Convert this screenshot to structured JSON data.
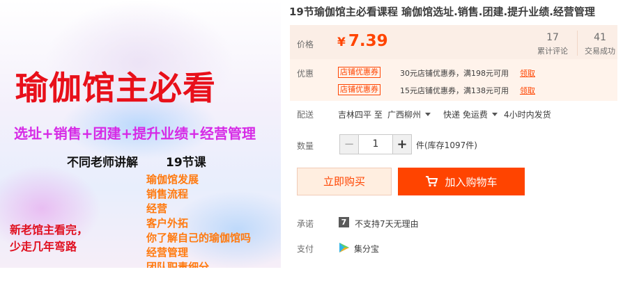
{
  "image": {
    "headline": "瑜伽馆主必看",
    "subline": "选址+销售+团建+提升业绩+经营管理",
    "teachers": "不同老师讲解",
    "lessons": "19节课",
    "topics": [
      "瑜伽馆发展",
      "销售流程",
      "经营",
      "客户外拓",
      "你了解自己的瑜伽馆吗",
      "经营管理",
      "团队职责细分"
    ],
    "newowner_line1": "新老馆主看完，",
    "newowner_line2": "少走几年弯路"
  },
  "product": {
    "title": "19节瑜伽馆主必看课程 瑜伽馆选址.销售.团建.提升业绩.经营管理"
  },
  "price": {
    "label": "价格",
    "currency": "¥",
    "value": "7.39"
  },
  "stats": {
    "reviews_count": "17",
    "reviews_label": "累计评论",
    "deals_count": "41",
    "deals_label": "交易成功"
  },
  "promo": {
    "label": "优惠",
    "items": [
      {
        "tag": "店铺优惠券",
        "text": "30元店铺优惠券，满198元可用",
        "action": "领取"
      },
      {
        "tag": "店铺优惠券",
        "text": "15元店铺优惠券，满138元可用",
        "action": "领取"
      }
    ]
  },
  "shipping": {
    "label": "配送",
    "from": "吉林四平 至",
    "to": "广西柳州",
    "method": "快递 免运费",
    "time": "4小时内发货"
  },
  "quantity": {
    "label": "数量",
    "minus": "−",
    "value": "1",
    "plus": "+",
    "stock": "件(库存1097件)"
  },
  "actions": {
    "buy_now": "立即购买",
    "add_cart": "加入购物车"
  },
  "promise": {
    "label": "承诺",
    "icon": "7",
    "text": "不支持7天无理由"
  },
  "payment": {
    "label": "支付",
    "text": "集分宝"
  },
  "colors": {
    "accent": "#ff4400",
    "price_bg": "#fbeee6"
  }
}
